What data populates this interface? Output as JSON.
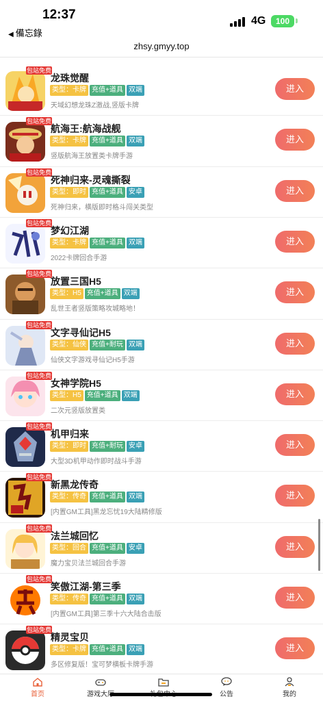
{
  "status_bar": {
    "time": "12:37",
    "back_app": "備忘錄",
    "network": "4G",
    "battery": "100"
  },
  "url": "zhsy.gmyy.top",
  "ribbon_label": "包站免费",
  "enter_label": "进入",
  "games": [
    {
      "title": "龙珠觉醒",
      "type": "类型：卡牌",
      "pay": "充值+道具",
      "platform": "双端",
      "desc": "天域幻想龙珠Z激战,竖版卡牌",
      "icon": "dragonball-icon"
    },
    {
      "title": "航海王:航海战舰",
      "type": "类型：卡牌",
      "pay": "充值+道具",
      "platform": "双端",
      "desc": "竖版航海王放置类卡牌手游",
      "icon": "onepiece-icon"
    },
    {
      "title": "死神归来-灵魂撕裂",
      "type": "类型：即时",
      "pay": "充值+道具",
      "platform": "安卓",
      "desc": "死神归来，横版即时格斗闯关类型",
      "icon": "bleach-icon"
    },
    {
      "title": "梦幻江湖",
      "type": "类型：卡牌",
      "pay": "充值+道具",
      "platform": "双端",
      "desc": "2022卡牌回合手游",
      "icon": "jianghu-icon"
    },
    {
      "title": "放置三国H5",
      "type": "类型：H5",
      "pay": "充值+道具",
      "platform": "双端",
      "desc": "乱世王者竖版策略攻城略地！",
      "icon": "sanguo-icon"
    },
    {
      "title": "文字寻仙记H5",
      "type": "类型：仙侠",
      "pay": "充值+耐玩",
      "platform": "双端",
      "desc": "仙侠文字游戏寻仙记H5手游",
      "icon": "xianxia-icon"
    },
    {
      "title": "女神学院H5",
      "type": "类型：H5",
      "pay": "充值+道具",
      "platform": "双端",
      "desc": "二次元竖版放置类",
      "icon": "anime-girl-icon"
    },
    {
      "title": "机甲归来",
      "type": "类型：即时",
      "pay": "充值+耐玩",
      "platform": "安卓",
      "desc": "大型3D机甲动作即时战斗手游",
      "icon": "mecha-icon"
    },
    {
      "title": "新黑龙传奇",
      "type": "类型：传奇",
      "pay": "充值+道具",
      "platform": "双端",
      "desc": "[内置GM工具]黑龙忘忧19大陆精修版",
      "icon": "legend-icon"
    },
    {
      "title": "法兰城回忆",
      "type": "类型：回合",
      "pay": "充值+道具",
      "platform": "安卓",
      "desc": "魔力宝贝法兰城回合手游",
      "icon": "falan-icon"
    },
    {
      "title": "笑傲江湖-第三季",
      "type": "类型：传奇",
      "pay": "充值+道具",
      "platform": "双端",
      "desc": "[内置GM工具]第三季十六大陆合击版",
      "icon": "xiao-icon"
    },
    {
      "title": "精灵宝贝",
      "type": "类型：卡牌",
      "pay": "充值+道具",
      "platform": "双端",
      "desc": "多区修复版！宝可梦横板卡牌手游",
      "icon": "pokeball-icon"
    }
  ],
  "tabbar": [
    {
      "label": "首页",
      "icon": "home-icon",
      "active": true
    },
    {
      "label": "游戏大厅",
      "icon": "gamepad-icon",
      "active": false
    },
    {
      "label": "礼包中心",
      "icon": "gift-folder-icon",
      "active": false
    },
    {
      "label": "公告",
      "icon": "chat-bubble-icon",
      "active": false
    },
    {
      "label": "我的",
      "icon": "user-icon",
      "active": false
    }
  ],
  "colors": {
    "accent": "#e8613a",
    "ribbon": "#e53935",
    "tag_type": "#f5c242",
    "tag_pay": "#4caf7d",
    "tag_platform": "#3aa0b5"
  }
}
